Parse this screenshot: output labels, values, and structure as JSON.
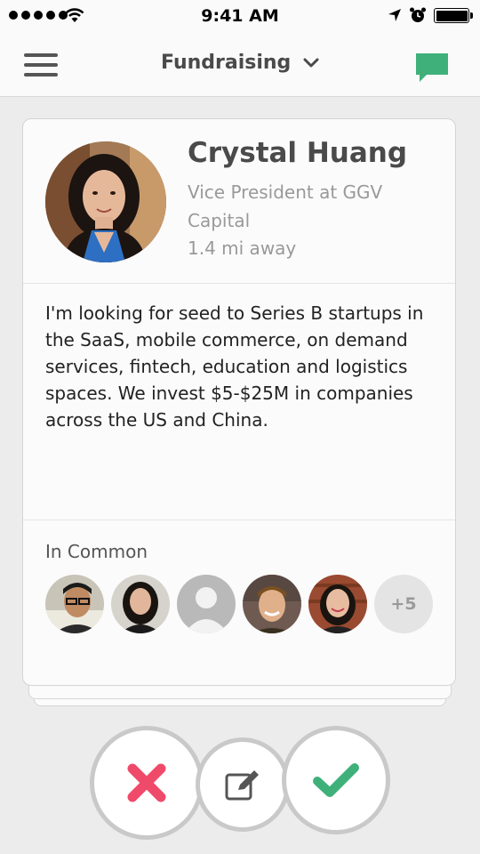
{
  "status_bar": {
    "time": "9:41 AM",
    "signal_bars": 5,
    "battery_level": 1.0
  },
  "nav": {
    "title": "Fundraising",
    "icons": [
      "menu-icon",
      "chevron-down-icon",
      "chat-icon"
    ],
    "accent_color": "#3fb07a"
  },
  "profile": {
    "name": "Crystal Huang",
    "title": "Vice President at GGV Capital",
    "distance": "1.4 mi away",
    "bio": "I'm looking for seed to Series B startups in the SaaS, mobile commerce, on demand services, fintech, education and logistics spaces. We invest $5-$25M in companies across the US and China."
  },
  "in_common": {
    "label": "In Common",
    "more_count": "+5"
  },
  "actions": {
    "icons": [
      "close-icon",
      "edit-icon",
      "check-icon"
    ],
    "reject_color": "#f04a6a",
    "accept_color": "#3fb07a"
  }
}
